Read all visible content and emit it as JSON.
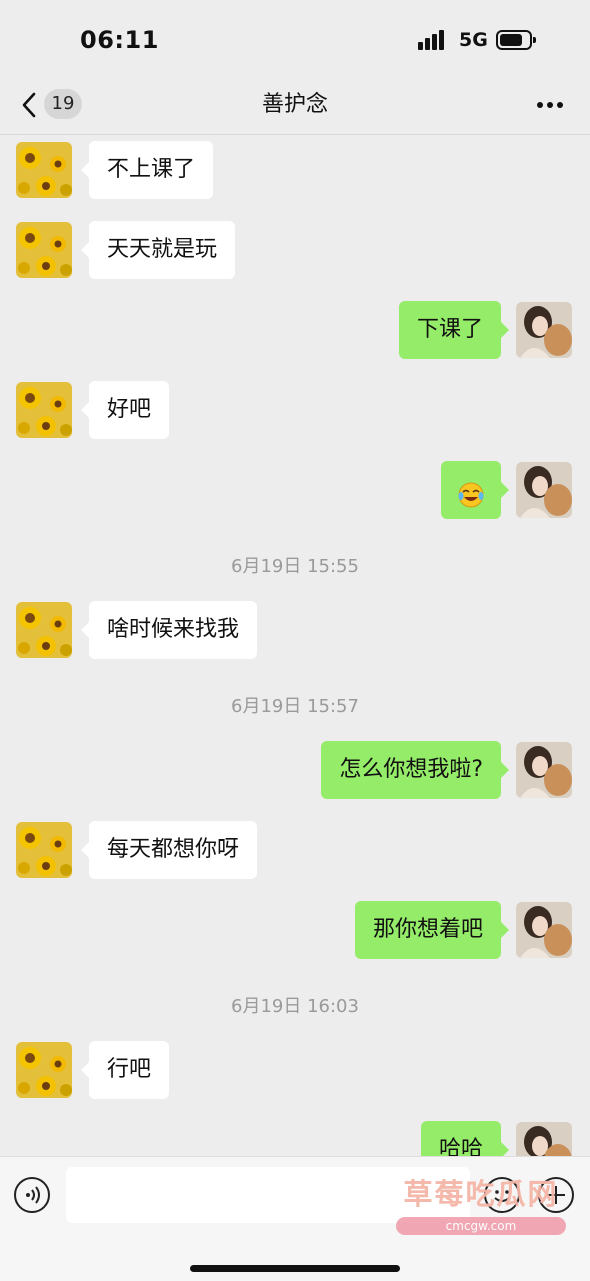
{
  "status_bar": {
    "time": "06:11",
    "network": "5G"
  },
  "nav": {
    "unread_count": "19",
    "title": "善护念"
  },
  "messages": [
    {
      "side": "left",
      "text": "不上课了"
    },
    {
      "side": "left",
      "text": "天天就是玩"
    },
    {
      "side": "right",
      "text": "下课了"
    },
    {
      "side": "left",
      "text": "好吧"
    },
    {
      "side": "right",
      "emoji": "tears-of-joy-emoji"
    },
    {
      "timestamp": "6月19日 15:55"
    },
    {
      "side": "left",
      "text": "啥时候来找我"
    },
    {
      "timestamp": "6月19日 15:57"
    },
    {
      "side": "right",
      "text": "怎么你想我啦?"
    },
    {
      "side": "left",
      "text": "每天都想你呀"
    },
    {
      "side": "right",
      "text": "那你想着吧"
    },
    {
      "timestamp": "6月19日 16:03"
    },
    {
      "side": "left",
      "text": "行吧"
    },
    {
      "side": "right",
      "text": "哈哈"
    }
  ],
  "input_bar": {
    "message_placeholder": ""
  },
  "watermark": {
    "text": "草莓吃瓜网",
    "url": "cmcgw.com"
  },
  "colors": {
    "background": "#ededed",
    "sent_bubble": "#95ec69",
    "received_bubble": "#ffffff",
    "timestamp_text": "#9a9a9a"
  }
}
